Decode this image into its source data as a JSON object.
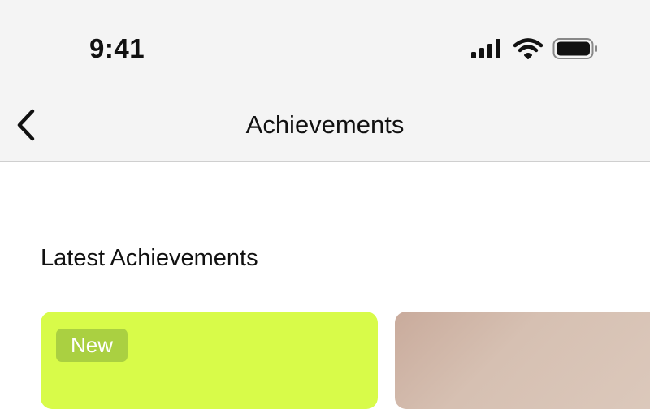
{
  "status_bar": {
    "time": "9:41",
    "icons": [
      "cellular-signal-icon",
      "wifi-icon",
      "battery-icon"
    ]
  },
  "nav": {
    "title": "Achievements",
    "back_icon": "chevron-left-icon"
  },
  "section": {
    "title": "Latest Achievements"
  },
  "cards": [
    {
      "badge": "New",
      "color": "#d8fb49"
    },
    {
      "color": "#cfb4a6"
    }
  ]
}
